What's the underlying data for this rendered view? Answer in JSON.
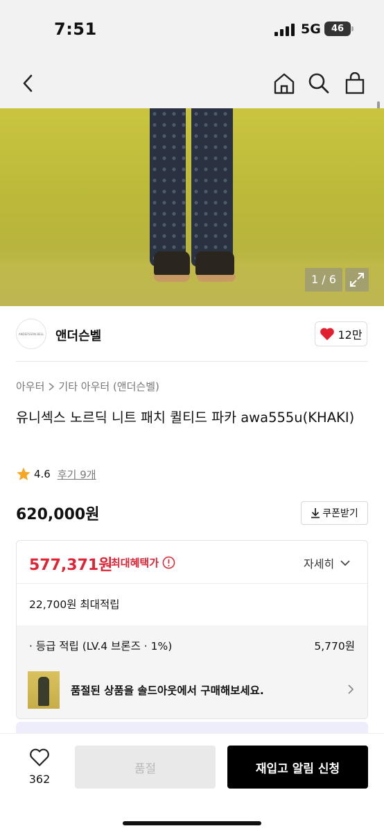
{
  "status_bar": {
    "time": "7:51",
    "network": "5G",
    "battery": "46"
  },
  "header": {
    "icons": [
      "back-icon",
      "home-icon",
      "search-icon",
      "shopping-bag-icon"
    ]
  },
  "gallery": {
    "counter": "1 / 6"
  },
  "brand": {
    "name": "앤더슨벨",
    "logo_text": "ANDERSSON BELL",
    "likes": "12만"
  },
  "breadcrumb": {
    "category": "아우터",
    "subcategory": "기타 아우터 (앤더슨벨)"
  },
  "product": {
    "title": "유니섹스 노르딕 니트 패치 퀼티드 파카 awa555u(KHAKI)",
    "rating": "4.6",
    "reviews": "후기 9개",
    "price": "620,000원",
    "coupon_label": "쿠폰받기"
  },
  "benefit": {
    "sale_price": "577,371원",
    "sale_label": "최대혜택가",
    "detail_label": "자세히",
    "points": "22,700원 최대적립",
    "grade_label": "· 등급 적립 (LV.4 브론즈 · 1%)",
    "grade_amount": "5,770원",
    "soldout_text": "품절된 상품을 솔드아웃에서 구매해보세요."
  },
  "bottom_bar": {
    "wish_count": "362",
    "soldout_label": "품절",
    "notify_label": "재입고 알림 신청"
  },
  "colors": {
    "sale_red": "#e02435",
    "heart_red": "#e0202f",
    "star": "#f5a623"
  }
}
